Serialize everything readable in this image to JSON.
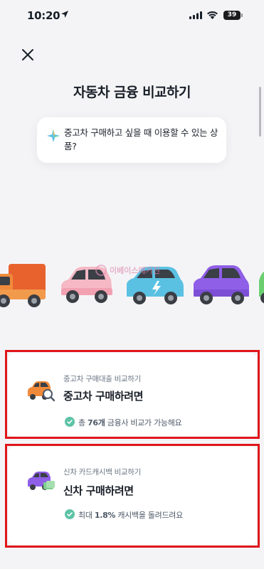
{
  "status_bar": {
    "time": "10:20",
    "battery": "39"
  },
  "header": {
    "title": "자동차 금융 비교하기"
  },
  "bubble": {
    "text": "중고차 구매하고 싶을 때 이용할 수 있는 상품?"
  },
  "watermark": {
    "text": "이베이스매거진"
  },
  "cards": [
    {
      "subtitle": "중고차 구매대출 비교하기",
      "title": "중고차 구매하려면",
      "info_prefix": "총 ",
      "info_highlight": "76개",
      "info_suffix": " 금융사 비교가 가능해요"
    },
    {
      "subtitle": "신차 카드캐시백 비교하기",
      "title": "신차 구매하려면",
      "info_prefix": "최대 ",
      "info_highlight": "1.8%",
      "info_suffix": " 캐시백을 돌려드려요"
    }
  ],
  "colors": {
    "highlight_frame": "#e0151b",
    "check": "#5ec3a5"
  }
}
